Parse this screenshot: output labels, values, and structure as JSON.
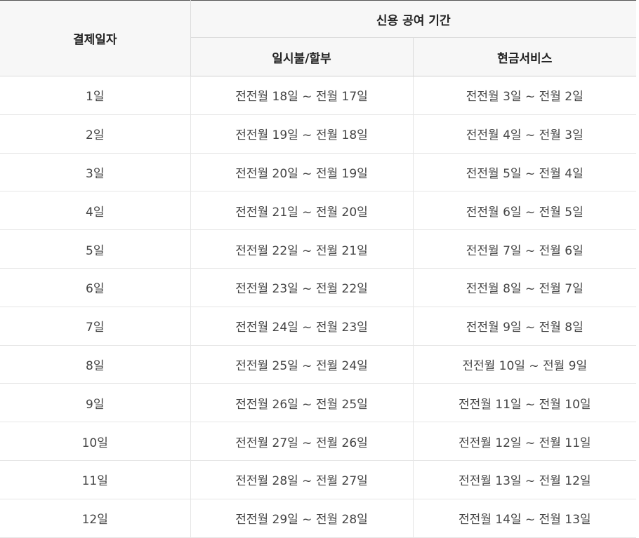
{
  "table": {
    "header": {
      "payment_day": "결제일자",
      "credit_period": "신용 공여 기간",
      "installment": "일시불/할부",
      "cash_service": "현금서비스"
    },
    "rows": [
      {
        "day": "1일",
        "installment": "전전월 18일 ~ 전월 17일",
        "cash": "전전월 3일 ~ 전월 2일"
      },
      {
        "day": "2일",
        "installment": "전전월 19일 ~ 전월 18일",
        "cash": "전전월 4일 ~ 전월 3일"
      },
      {
        "day": "3일",
        "installment": "전전월 20일 ~ 전월 19일",
        "cash": "전전월 5일 ~ 전월 4일"
      },
      {
        "day": "4일",
        "installment": "전전월 21일 ~ 전월 20일",
        "cash": "전전월 6일 ~ 전월 5일"
      },
      {
        "day": "5일",
        "installment": "전전월 22일 ~ 전월 21일",
        "cash": "전전월 7일 ~ 전월 6일"
      },
      {
        "day": "6일",
        "installment": "전전월 23일 ~ 전월 22일",
        "cash": "전전월 8일 ~ 전월 7일"
      },
      {
        "day": "7일",
        "installment": "전전월 24일 ~ 전월 23일",
        "cash": "전전월 9일 ~ 전월 8일"
      },
      {
        "day": "8일",
        "installment": "전전월 25일 ~ 전월 24일",
        "cash": "전전월 10일 ~ 전월 9일"
      },
      {
        "day": "9일",
        "installment": "전전월 26일 ~ 전월 25일",
        "cash": "전전월 11일 ~ 전월 10일"
      },
      {
        "day": "10일",
        "installment": "전전월 27일 ~ 전월 26일",
        "cash": "전전월 12일 ~ 전월 11일"
      },
      {
        "day": "11일",
        "installment": "전전월 28일 ~ 전월 27일",
        "cash": "전전월 13일 ~ 전월 12일"
      },
      {
        "day": "12일",
        "installment": "전전월 29일 ~ 전월 28일",
        "cash": "전전월 14일 ~ 전월 13일"
      }
    ]
  }
}
